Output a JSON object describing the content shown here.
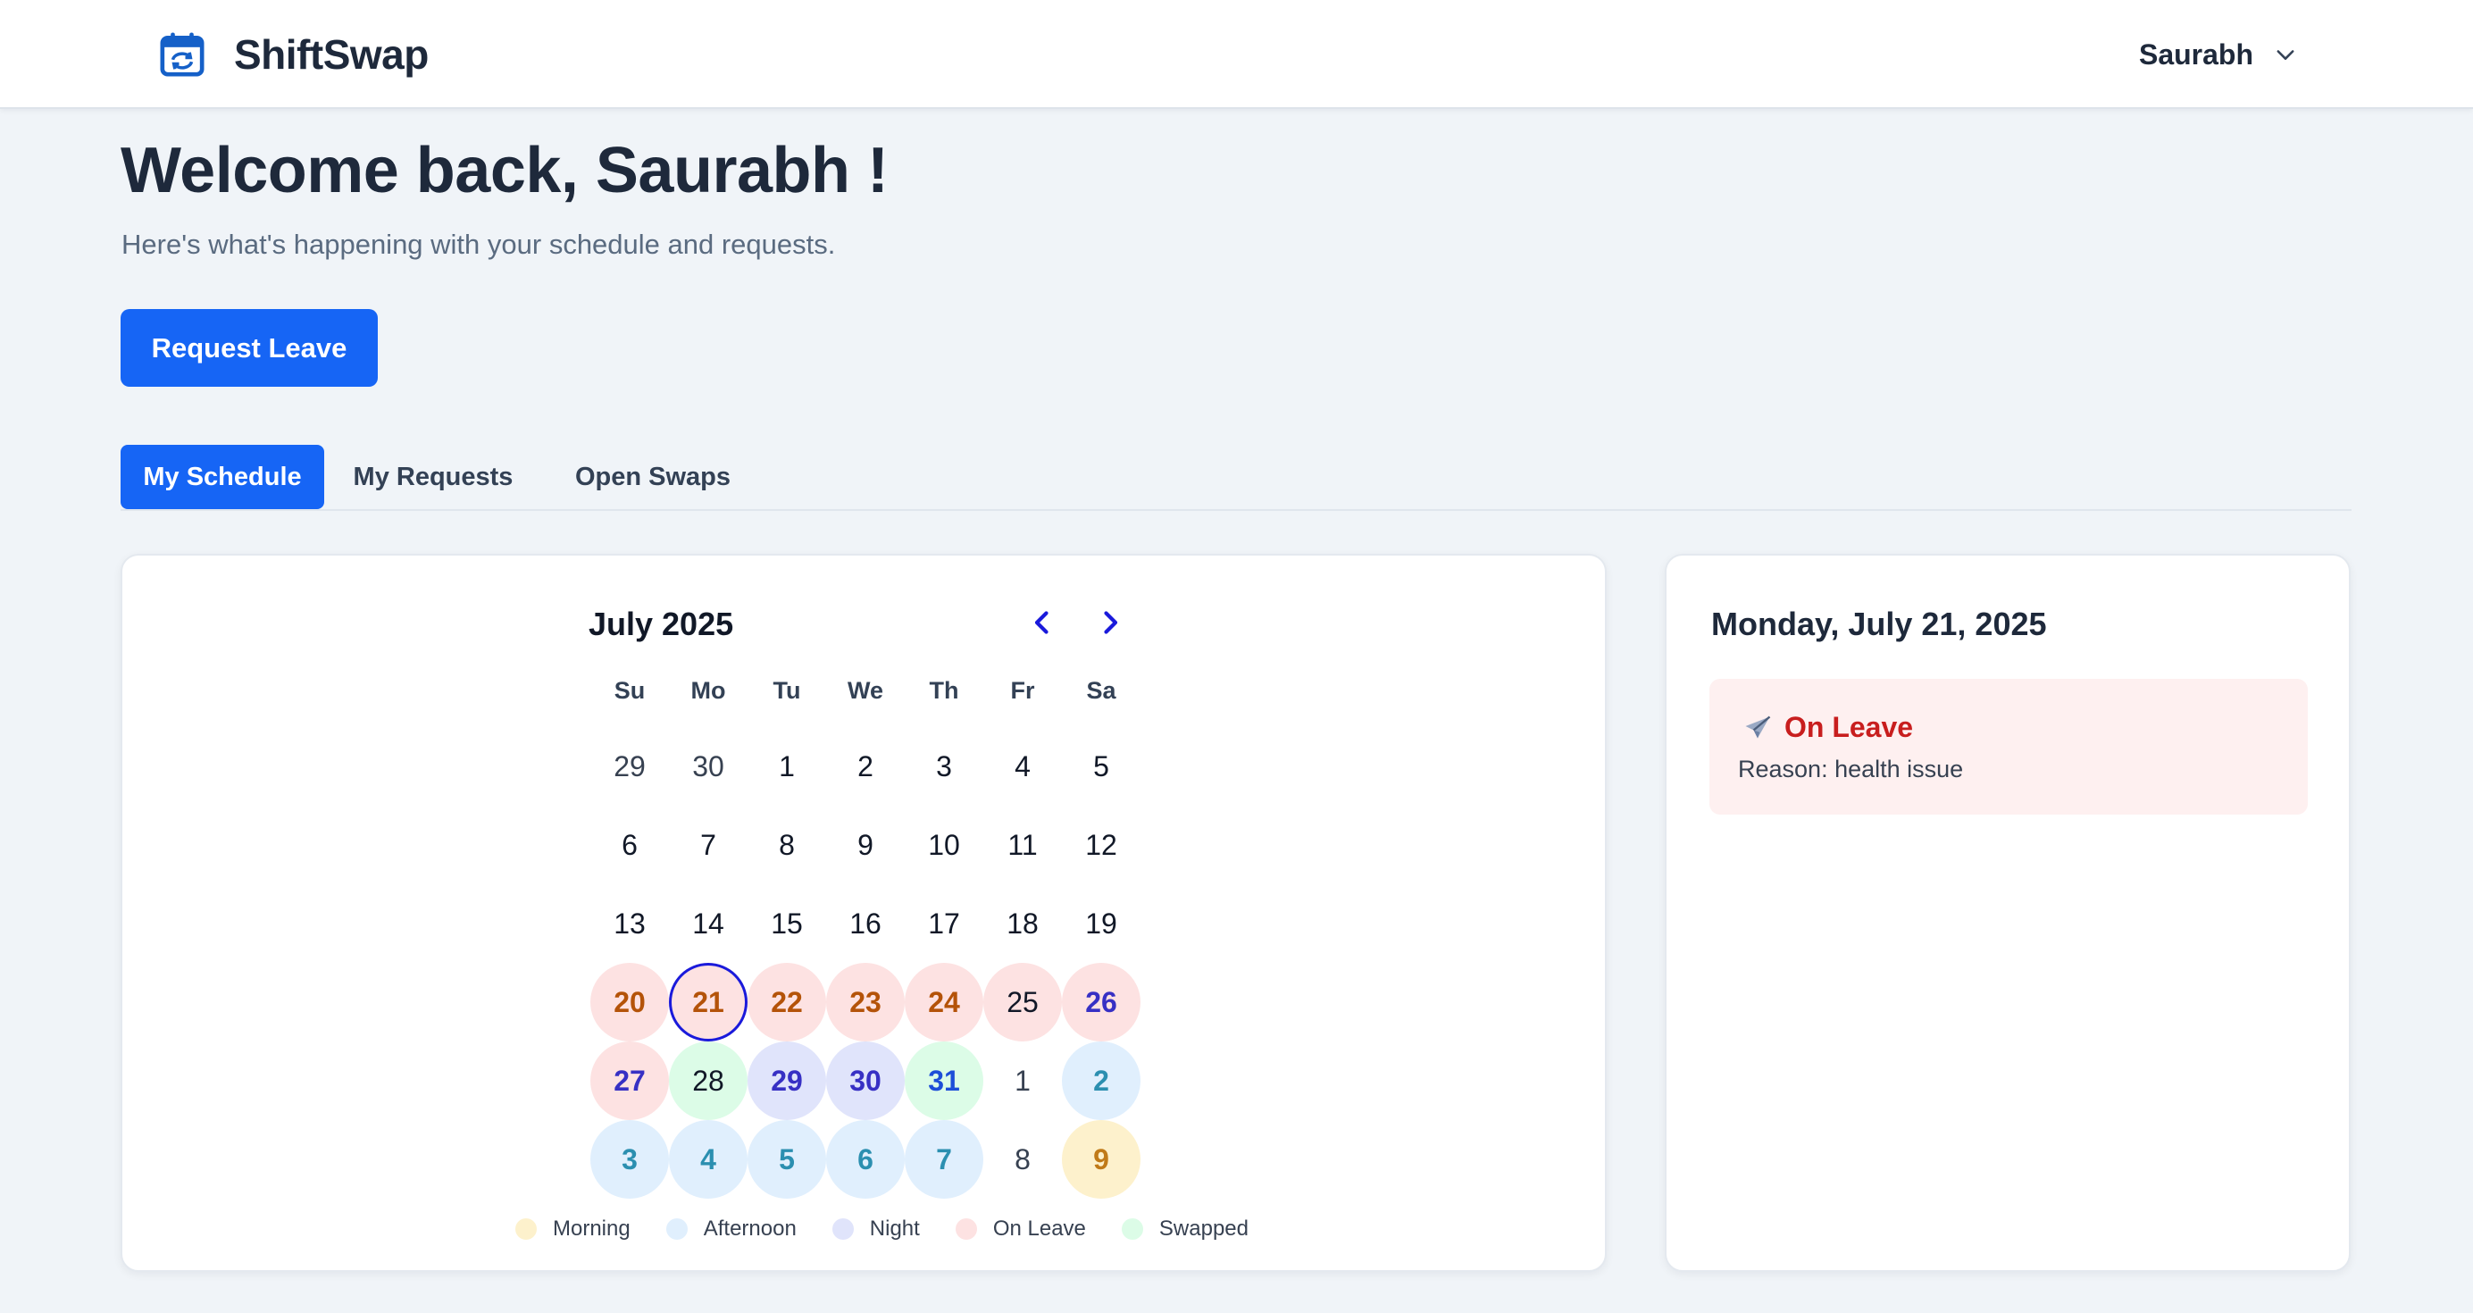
{
  "header": {
    "app_name": "ShiftSwap",
    "user_name": "Saurabh",
    "brand_icon": "calendar-swap-icon",
    "accent": "#1665f5"
  },
  "welcome": {
    "title": "Welcome back, Saurabh !",
    "subtitle": "Here's what's happening with your schedule and requests.",
    "request_leave_label": "Request Leave"
  },
  "tabs": [
    {
      "label": "My Schedule",
      "active": true
    },
    {
      "label": "My Requests",
      "active": false
    },
    {
      "label": "Open Swaps",
      "active": false
    }
  ],
  "calendar": {
    "month_label": "July 2025",
    "weekdays": [
      "Su",
      "Mo",
      "Tu",
      "We",
      "Th",
      "Fr",
      "Sa"
    ],
    "days": [
      {
        "label": "29",
        "type": "muted"
      },
      {
        "label": "30",
        "type": "muted"
      },
      {
        "label": "1",
        "type": "plain"
      },
      {
        "label": "2",
        "type": "plain"
      },
      {
        "label": "3",
        "type": "plain"
      },
      {
        "label": "4",
        "type": "plain"
      },
      {
        "label": "5",
        "type": "plain"
      },
      {
        "label": "6",
        "type": "plain"
      },
      {
        "label": "7",
        "type": "plain"
      },
      {
        "label": "8",
        "type": "plain"
      },
      {
        "label": "9",
        "type": "plain"
      },
      {
        "label": "10",
        "type": "plain"
      },
      {
        "label": "11",
        "type": "plain"
      },
      {
        "label": "12",
        "type": "plain"
      },
      {
        "label": "13",
        "type": "plain"
      },
      {
        "label": "14",
        "type": "plain"
      },
      {
        "label": "15",
        "type": "plain"
      },
      {
        "label": "16",
        "type": "plain"
      },
      {
        "label": "17",
        "type": "plain"
      },
      {
        "label": "18",
        "type": "plain"
      },
      {
        "label": "19",
        "type": "plain"
      },
      {
        "label": "20",
        "type": "leave"
      },
      {
        "label": "21",
        "type": "leave selected"
      },
      {
        "label": "22",
        "type": "leave"
      },
      {
        "label": "23",
        "type": "leave"
      },
      {
        "label": "24",
        "type": "leave"
      },
      {
        "label": "25",
        "type": "leave plain"
      },
      {
        "label": "26",
        "type": "leave night-text"
      },
      {
        "label": "27",
        "type": "leave night-text"
      },
      {
        "label": "28",
        "type": "swapped plain"
      },
      {
        "label": "29",
        "type": "night"
      },
      {
        "label": "30",
        "type": "night"
      },
      {
        "label": "31",
        "type": "swapped"
      },
      {
        "label": "1",
        "type": "muted"
      },
      {
        "label": "2",
        "type": "afternoon"
      },
      {
        "label": "3",
        "type": "afternoon"
      },
      {
        "label": "4",
        "type": "afternoon"
      },
      {
        "label": "5",
        "type": "afternoon"
      },
      {
        "label": "6",
        "type": "afternoon"
      },
      {
        "label": "7",
        "type": "afternoon"
      },
      {
        "label": "8",
        "type": "muted"
      },
      {
        "label": "9",
        "type": "morning"
      }
    ],
    "legend": [
      {
        "label": "Morning",
        "color": "#fdf1cc"
      },
      {
        "label": "Afternoon",
        "color": "#e0effd"
      },
      {
        "label": "Night",
        "color": "#e0e4fb"
      },
      {
        "label": "On Leave",
        "color": "#fde2e2"
      },
      {
        "label": "Swapped",
        "color": "#dcfce7"
      }
    ]
  },
  "detail": {
    "date_label": "Monday, July 21, 2025",
    "status_icon": "airplane-icon",
    "status": "On Leave",
    "reason": "Reason: health issue"
  }
}
